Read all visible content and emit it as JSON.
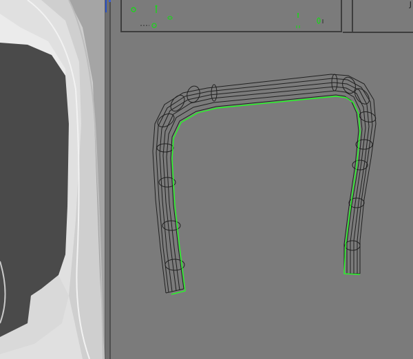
{
  "viewports": {
    "left": {
      "shading": "smooth"
    },
    "right": {
      "shading": "wireframe"
    }
  },
  "toolbar": {
    "corner_label": "J"
  },
  "icons": {
    "toolbar_icon_1": "curve-icon",
    "toolbar_icon_2": "key-icon",
    "toolbar_icon_3": "dot-icon",
    "toolbar_icon_4": "pin-icon",
    "toolbar_icon_5": "node-icon"
  },
  "colors": {
    "wireframe": "#1f1f1f",
    "selection_edge": "#22ff22",
    "viewport_bg": "#7b7b7b",
    "left_bg": "#a9a9a9"
  }
}
